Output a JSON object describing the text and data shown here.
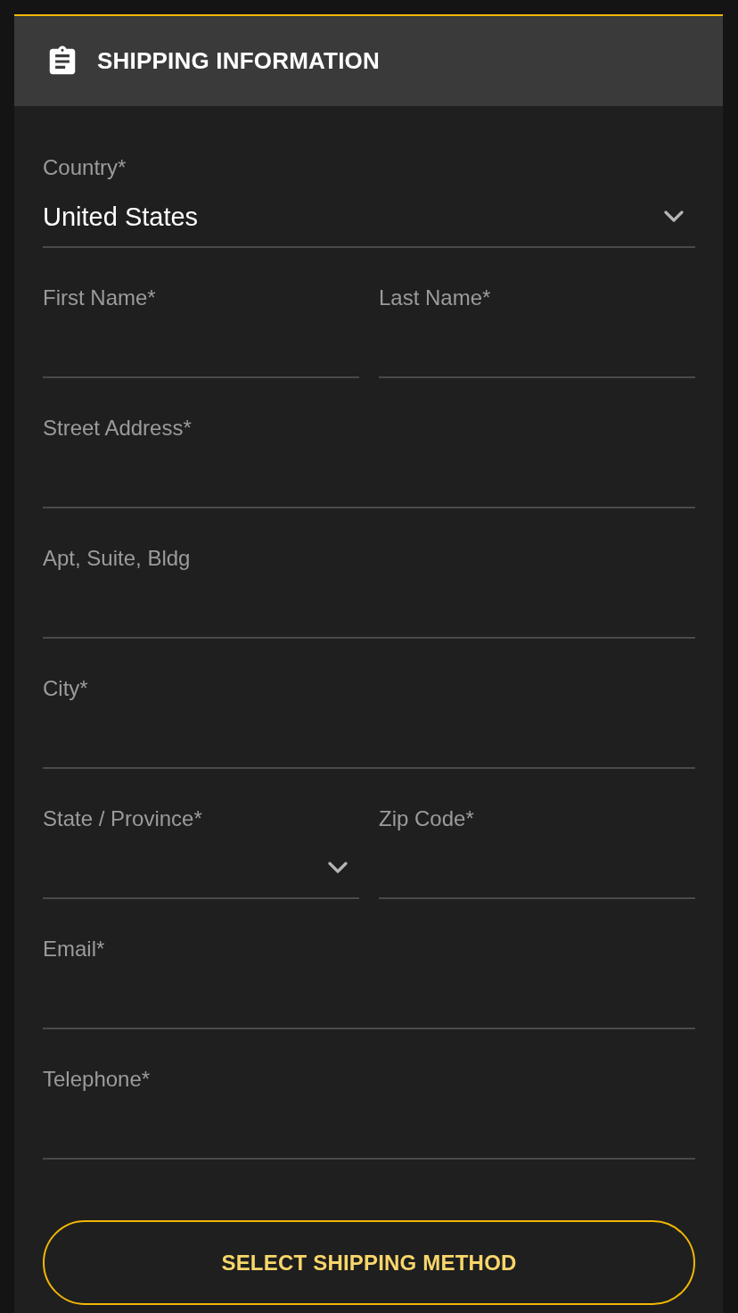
{
  "header": {
    "title": "SHIPPING INFORMATION"
  },
  "rows": [
    {
      "fields": [
        {
          "label": "Country*",
          "kind": "select",
          "value": "United States"
        }
      ]
    },
    {
      "fields": [
        {
          "label": "First Name*",
          "kind": "text"
        },
        {
          "label": "Last Name*",
          "kind": "text"
        }
      ]
    },
    {
      "fields": [
        {
          "label": "Street Address*",
          "kind": "text"
        }
      ]
    },
    {
      "fields": [
        {
          "label": "Apt, Suite, Bldg",
          "kind": "text"
        }
      ]
    },
    {
      "fields": [
        {
          "label": "City*",
          "kind": "text"
        }
      ]
    },
    {
      "fields": [
        {
          "label": "State / Province*",
          "kind": "select"
        },
        {
          "label": "Zip Code*",
          "kind": "text"
        }
      ]
    },
    {
      "fields": [
        {
          "label": "Email*",
          "kind": "text"
        }
      ]
    },
    {
      "fields": [
        {
          "label": "Telephone*",
          "kind": "text"
        }
      ]
    }
  ],
  "button": {
    "label": "SELECT SHIPPING METHOD"
  }
}
